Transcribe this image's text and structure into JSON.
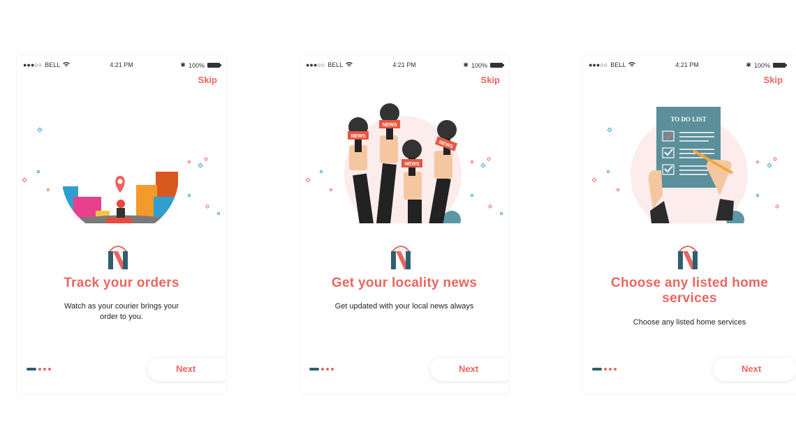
{
  "status_bar": {
    "carrier": "BELL",
    "time": "4:21 PM",
    "battery": "100%"
  },
  "colors": {
    "accent": "#e8665f",
    "teal": "#2f5f6d",
    "background": "#ffffff"
  },
  "screens": [
    {
      "skip_label": "Skip",
      "title": "Track your orders",
      "description": "Watch as your courier brings your order to you.",
      "next_label": "Next",
      "page_indicator": {
        "current": 1,
        "total": 4
      },
      "illustration": "courier-scooter-city-illustration"
    },
    {
      "skip_label": "Skip",
      "title": "Get your locality news",
      "description": "Get updated with your local news always",
      "next_label": "Next",
      "page_indicator": {
        "current": 1,
        "total": 4
      },
      "illustration": "news-microphones-illustration",
      "mic_labels": [
        "NEWS",
        "NEWS",
        "NEWS",
        "NEWS"
      ]
    },
    {
      "skip_label": "Skip",
      "title": "Choose any listed home services",
      "description": "Choose any listed home services",
      "next_label": "Next",
      "page_indicator": {
        "current": 1,
        "total": 4
      },
      "illustration": "todo-list-illustration",
      "card_title": "TO DO LIST"
    }
  ]
}
